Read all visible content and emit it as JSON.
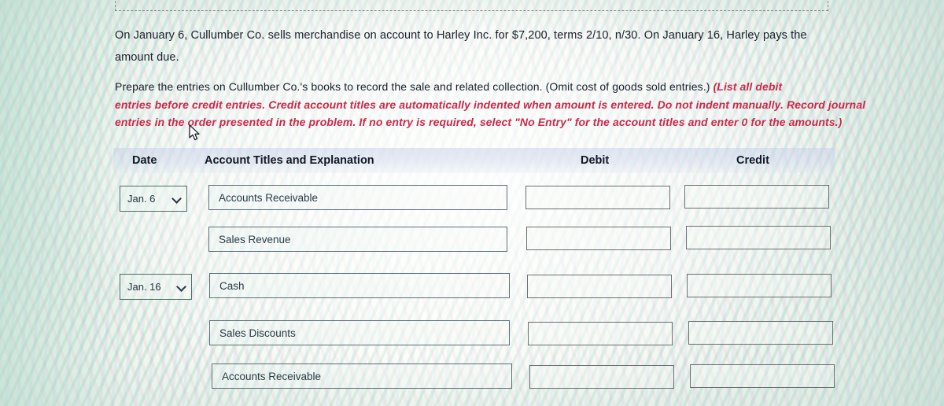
{
  "problem": {
    "line1": "On January 6, Cullumber Co. sells merchandise on account to Harley Inc. for $7,200, terms 2/10, n/30. On January 16, Harley pays the",
    "line2": "amount due."
  },
  "instructions": {
    "plain1": "Prepare the entries on Cullumber Co.'s books to record the sale and related collection. (Omit cost of goods sold entries.) ",
    "red1": "(List all debit",
    "red2": "entries before credit entries. Credit account titles are automatically indented when amount is entered. Do not indent manually. Record journal",
    "red3": "entries in the order presented in the problem. If no entry is required, select \"No Entry\" for the account titles and enter 0 for the amounts.)"
  },
  "table": {
    "headers": {
      "date": "Date",
      "account": "Account Titles and Explanation",
      "debit": "Debit",
      "credit": "Credit"
    },
    "rows": [
      {
        "date": "Jan. 6",
        "has_date": true,
        "account": "Accounts Receivable",
        "debit": "",
        "credit": ""
      },
      {
        "date": "",
        "has_date": false,
        "account": "Sales Revenue",
        "debit": "",
        "credit": ""
      },
      {
        "date": "Jan. 16",
        "has_date": true,
        "account": "Cash",
        "debit": "",
        "credit": ""
      },
      {
        "date": "",
        "has_date": false,
        "account": "Sales Discounts",
        "debit": "",
        "credit": ""
      },
      {
        "date": "",
        "has_date": false,
        "account": "Accounts Receivable",
        "debit": "",
        "credit": ""
      }
    ]
  },
  "icons": {
    "chevron": "chevron-down-icon",
    "cursor": "mouse-pointer-cursor"
  },
  "colors": {
    "red_emphasis": "#c92a4a",
    "text": "#18202b",
    "field_border": "#5c6f77",
    "header_band": "#c4cee8"
  }
}
